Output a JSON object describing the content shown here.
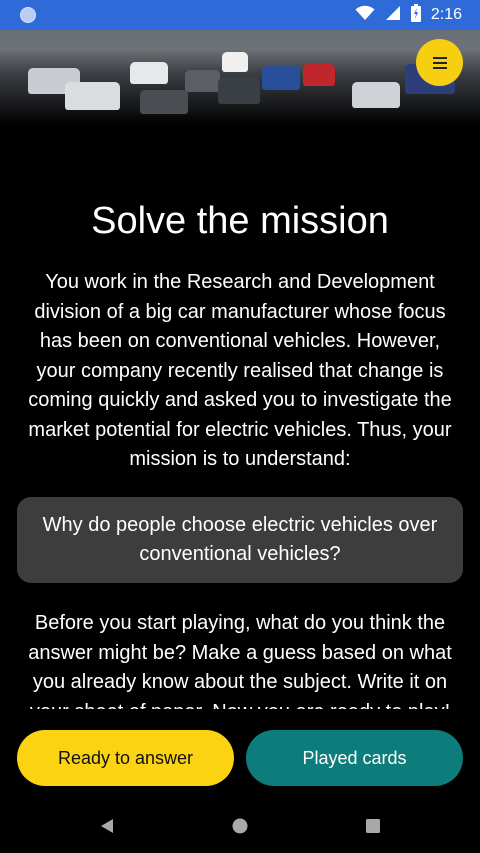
{
  "status_bar": {
    "time": "2:16",
    "icons": [
      "notification-dot-icon",
      "wifi-icon",
      "cellular-signal-icon",
      "battery-icon"
    ]
  },
  "header": {
    "hero_image": "cars-on-runway-photo",
    "menu_button_icon": "menu-icon",
    "accent_color": "#f5cf10"
  },
  "main": {
    "title": "Solve the mission",
    "intro": "You work in the Research and Development division of a big car manufacturer whose focus has been on conventional vehicles. However, your company recently realised that change is coming quickly and asked you to investigate the market potential for electric vehicles. Thus, your mission is to understand:",
    "question": "Why do people choose electric vehicles over conventional vehicles?",
    "prompt": "Before you start playing, what do you think the answer might be? Make a guess based on what you already know about the subject. Write it on your sheet of paper. Now you are ready to play!"
  },
  "actions": {
    "ready_label": "Ready to answer",
    "played_label": "Played cards",
    "ready_color": "#fbd313",
    "played_color": "#0c7d7b"
  },
  "nav": {
    "icons": [
      "back-icon",
      "home-icon",
      "recents-icon"
    ]
  }
}
